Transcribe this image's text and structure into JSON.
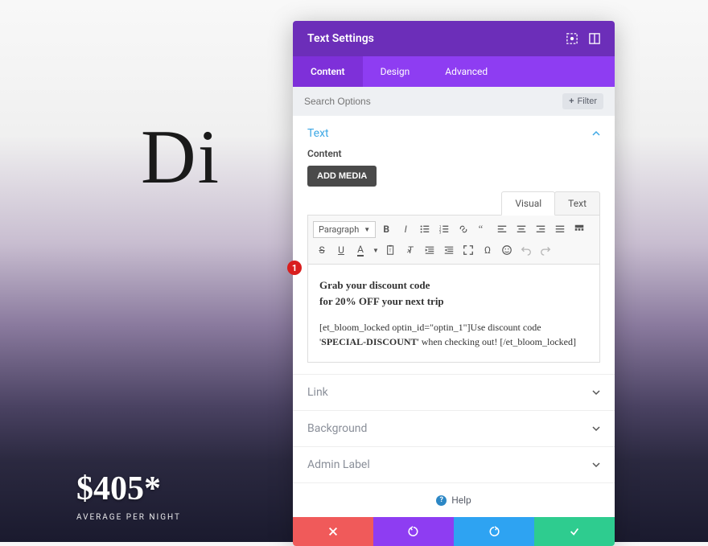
{
  "bg": {
    "text": "Di",
    "price": "$405*",
    "price_label": "AVERAGE PER NIGHT"
  },
  "modal": {
    "title": "Text Settings",
    "tabs": {
      "content": "Content",
      "design": "Design",
      "advanced": "Advanced"
    },
    "search": {
      "placeholder": "Search Options",
      "filter": "Filter"
    },
    "sections": {
      "text": {
        "title": "Text",
        "content_label": "Content",
        "add_media": "ADD MEDIA"
      },
      "link": "Link",
      "background": "Background",
      "admin": "Admin Label"
    },
    "editor": {
      "tabs": {
        "visual": "Visual",
        "text": "Text"
      },
      "format": "Paragraph",
      "head1": "Grab your discount code",
      "head2": "for 20% OFF your next trip",
      "body_pre": "[et_bloom_locked optin_id=\"optin_1\"]Use discount code '",
      "body_bold": "SPECIAL-DISCOUNT",
      "body_post": "' when checking out! [/et_bloom_locked]"
    },
    "help": "Help"
  },
  "callout": "1"
}
